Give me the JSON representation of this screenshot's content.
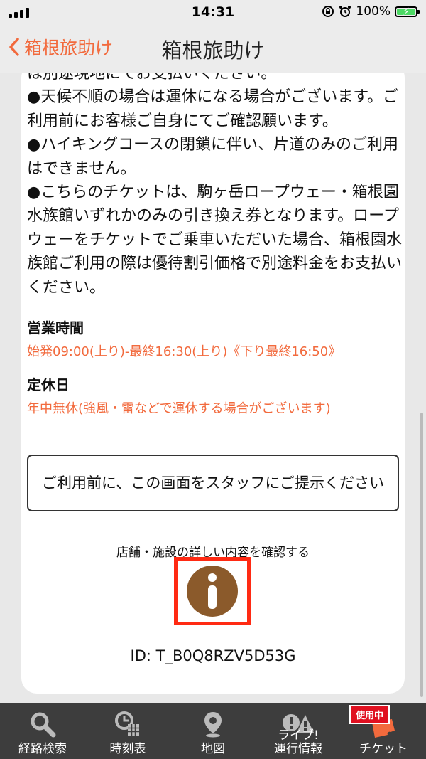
{
  "status": {
    "time": "14:31",
    "battery": "100%"
  },
  "nav": {
    "back_label": "箱根旅助け",
    "title": "箱根旅助け"
  },
  "notes": [
    "は別途現地にてお支払いください。",
    "●天候不順の場合は運休になる場合がございます。ご利用前にお客様ご自身にてご確認願います。",
    "●ハイキングコースの閉鎖に伴い、片道のみのご利用はできません。",
    "●こちらのチケットは、駒ヶ岳ロープウェー・箱根園水族館いずれかのみの引き換え券となります。ロープウェーをチケットでご乗車いただいた場合、箱根園水族館ご利用の際は優待割引価格で別途料金をお支払いください。"
  ],
  "hours": {
    "heading": "営業時間",
    "value": "始発09:00(上り)-最終16:30(上り)《下り最終16:50》"
  },
  "holidays": {
    "heading": "定休日",
    "value": "年中無休(強風・雷などで運休する場合がございます)"
  },
  "staff_notice": "ご利用前に、この画面をスタッフにご提示ください",
  "detail_label": "店舗・施設の詳しい内容を確認する",
  "ticket_id": "ID: T_B0Q8RZV5D53G",
  "tabs": [
    {
      "label": "経路検索",
      "icon": "search-icon"
    },
    {
      "label": "時刻表",
      "icon": "timetable-icon"
    },
    {
      "label": "地図",
      "icon": "map-pin-icon"
    },
    {
      "label": "ライブ!\n運行情報",
      "icon": "alert-icon"
    },
    {
      "label": "チケット",
      "icon": "ticket-icon",
      "badge": "使用中"
    }
  ],
  "colors": {
    "accent": "#f26a3d",
    "info_icon": "#8b5a2b",
    "highlight": "#ff2a13",
    "tabbar": "#3d3d3d"
  }
}
